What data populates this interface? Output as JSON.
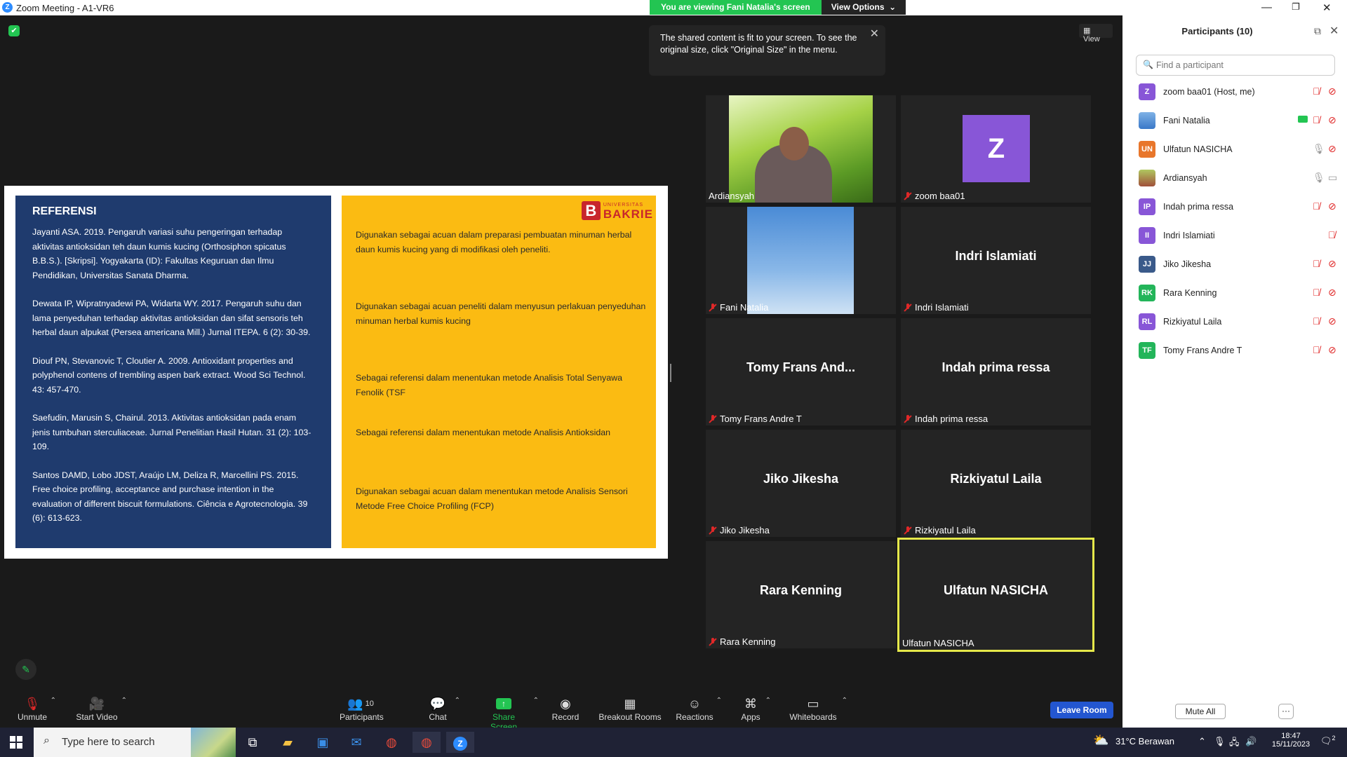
{
  "window": {
    "title": "Zoom Meeting - A1-VR6",
    "controls": [
      "—",
      "❐",
      "✕"
    ]
  },
  "banner": {
    "viewing": "You are viewing Fani Natalia's screen",
    "options": "View Options"
  },
  "tooltip": {
    "text": "The shared content is fit to your screen. To see the original size, click \"Original Size\" in the menu."
  },
  "view_button": "View",
  "slide": {
    "title": "REFERENSI",
    "references": [
      "Jayanti ASA. 2019. Pengaruh variasi suhu pengeringan terhadap aktivitas antioksidan teh daun kumis kucing (Orthosiphon spicatus B.B.S.). [Skripsi]. Yogyakarta (ID): Fakultas Keguruan dan Ilmu Pendidikan, Universitas Sanata Dharma.",
      "Dewata IP, Wipratnyadewi PA, Widarta WY. 2017. Pengaruh suhu dan lama penyeduhan terhadap aktivitas antioksidan dan sifat sensoris teh herbal daun alpukat (Persea americana Mill.) Jurnal ITEPA. 6 (2): 30-39.",
      "Diouf PN, Stevanovic T, Cloutier A. 2009. Antioxidant properties and polyphenol contens of trembling aspen bark extract. Wood Sci Technol. 43: 457-470.",
      "Saefudin, Marusin S, Chairul. 2013. Aktivitas antioksidan pada enam jenis tumbuhan sterculiaceae. Jurnal Penelitian Hasil Hutan. 31 (2): 103-109.",
      "Santos DAMD, Lobo JDST, Araújo LM, Deliza R, Marcellini PS. 2015. Free choice profiling, acceptance and purchase intention in the evaluation of different biscuit formulations. Ciência e Agrotecnologia. 39 (6): 613-623."
    ],
    "notes": [
      "Digunakan sebagai acuan dalam preparasi pembuatan minuman herbal daun kumis kucing yang di modifikasi oleh peneliti.",
      "Digunakan sebagai acuan peneliti dalam menyusun perlakuan penyeduhan minuman herbal kumis kucing",
      "Sebagai referensi dalam menentukan  metode Analisis Total Senyawa Fenolik (TSF",
      "Sebagai referensi dalam menentukan metode Analisis Antioksidan",
      "Digunakan sebagai acuan dalam menentukan metode Analisis Sensori Metode Free Choice Profiling (FCP)"
    ],
    "logo": {
      "letter": "B",
      "top": "UNIVERSITAS",
      "name": "BAKRIE"
    }
  },
  "tiles": [
    {
      "big": "",
      "label": "Ardiansyah",
      "muted": false
    },
    {
      "big": "Z",
      "label": "zoom baa01",
      "muted": true
    },
    {
      "big": "",
      "label": "Fani Natalia",
      "muted": true
    },
    {
      "big": "Indri Islamiati",
      "label": "Indri Islamiati",
      "muted": true
    },
    {
      "big": "Tomy Frans And...",
      "label": "Tomy Frans Andre T",
      "muted": true
    },
    {
      "big": "Indah prima ressa",
      "label": "Indah prima ressa",
      "muted": true
    },
    {
      "big": "Jiko Jikesha",
      "label": "Jiko Jikesha",
      "muted": true
    },
    {
      "big": "Rizkiyatul Laila",
      "label": "Rizkiyatul Laila",
      "muted": true
    },
    {
      "big": "Rara Kenning",
      "label": "Rara Kenning",
      "muted": true
    },
    {
      "big": "Ulfatun NASICHA",
      "label": "Ulfatun NASICHA",
      "muted": false
    }
  ],
  "toolbar": {
    "unmute": "Unmute",
    "start_video": "Start Video",
    "participants": "Participants",
    "participants_count": "10",
    "chat": "Chat",
    "share_screen": "Share Screen",
    "record": "Record",
    "breakout_rooms": "Breakout Rooms",
    "reactions": "Reactions",
    "apps": "Apps",
    "whiteboards": "Whiteboards",
    "leave": "Leave Room"
  },
  "panel": {
    "title": "Participants (10)",
    "search_placeholder": "Find a participant",
    "mute_all": "Mute All",
    "more": "···",
    "participants": [
      {
        "initials": "Z",
        "name": "zoom baa01 (Host, me)",
        "color": "#8856d7"
      },
      {
        "initials": "",
        "name": "Fani Natalia",
        "color": "#4a86d4"
      },
      {
        "initials": "UN",
        "name": "Ulfatun NASICHA",
        "color": "#e8762b"
      },
      {
        "initials": "",
        "name": "Ardiansyah",
        "color": "#7a9a3a"
      },
      {
        "initials": "IP",
        "name": "Indah prima ressa",
        "color": "#8856d7"
      },
      {
        "initials": "II",
        "name": "Indri Islamiati",
        "color": "#8856d7"
      },
      {
        "initials": "JJ",
        "name": "Jiko Jikesha",
        "color": "#3a5a8a"
      },
      {
        "initials": "RK",
        "name": "Rara Kenning",
        "color": "#23b55a"
      },
      {
        "initials": "RL",
        "name": "Rizkiyatul Laila",
        "color": "#8856d7"
      },
      {
        "initials": "TF",
        "name": "Tomy Frans Andre T",
        "color": "#23b55a"
      }
    ]
  },
  "taskbar": {
    "search_placeholder": "Type here to search",
    "weather": "31°C  Berawan",
    "time": "18:47",
    "date": "15/11/2023",
    "notifications": "2"
  }
}
